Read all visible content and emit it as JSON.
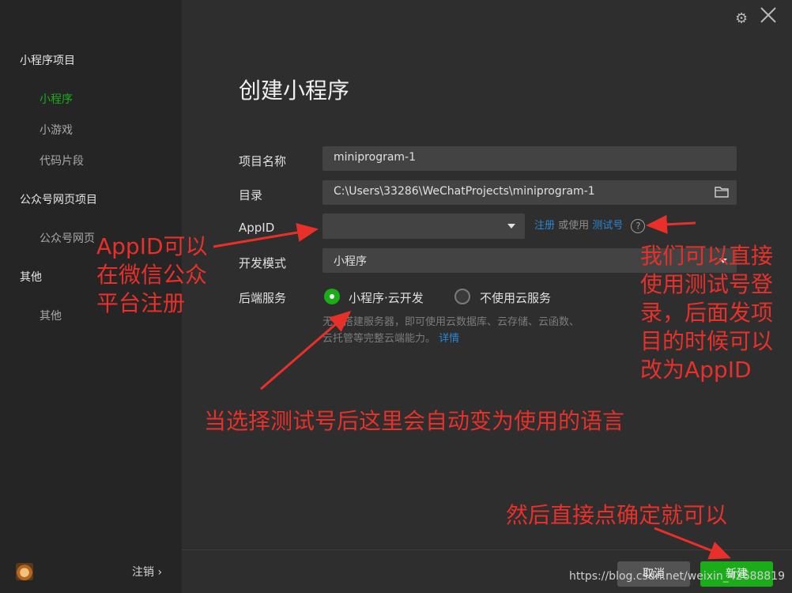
{
  "sidebar": {
    "group_miniprogram": "小程序项目",
    "items_miniprogram": [
      "小程序",
      "小游戏",
      "代码片段"
    ],
    "group_official": "公众号网页项目",
    "items_official": [
      "公众号网页"
    ],
    "group_other": "其他",
    "items_other": [
      "其他"
    ],
    "logout": "注销 ›"
  },
  "dialog": {
    "title": "创建小程序",
    "project_name_label": "项目名称",
    "project_name_value": "miniprogram-1",
    "directory_label": "目录",
    "directory_value": "C:\\Users\\33286\\WeChatProjects\\miniprogram-1",
    "appid_label": "AppID",
    "appid_value": "",
    "register_link": "注册",
    "or_use": "或使用",
    "test_account_link": "测试号",
    "help_icon_glyph": "?",
    "dev_mode_label": "开发模式",
    "dev_mode_value": "小程序",
    "backend_label": "后端服务",
    "backend_option_cloud": "小程序·云开发",
    "backend_option_none": "不使用云服务",
    "backend_desc": "无需搭建服务器，即可使用云数据库、云存储、云函数、云托管等完整云端能力。",
    "details_link": "详情",
    "cancel_button": "取消",
    "create_button": "新建"
  },
  "annotations": {
    "appid_note": [
      "AppID可以",
      "在微信公众",
      "平台注册"
    ],
    "test_note": [
      "我们可以直接",
      "使用测试号登",
      "录，后面发项",
      "目的时候可以",
      "改为AppID"
    ],
    "lang_note": "当选择测试号后这里会自动变为使用的语言",
    "confirm_note": "然后直接点确定就可以",
    "watermark": "https://blog.csdn.net/weixin_42688819"
  },
  "colors": {
    "accent": "#1aad19",
    "link": "#2b87d1",
    "annotation": "#e8302b"
  },
  "icons": [
    "gear-icon",
    "close-icon",
    "folder-icon",
    "chevron-down-icon",
    "help-icon",
    "avatar"
  ]
}
